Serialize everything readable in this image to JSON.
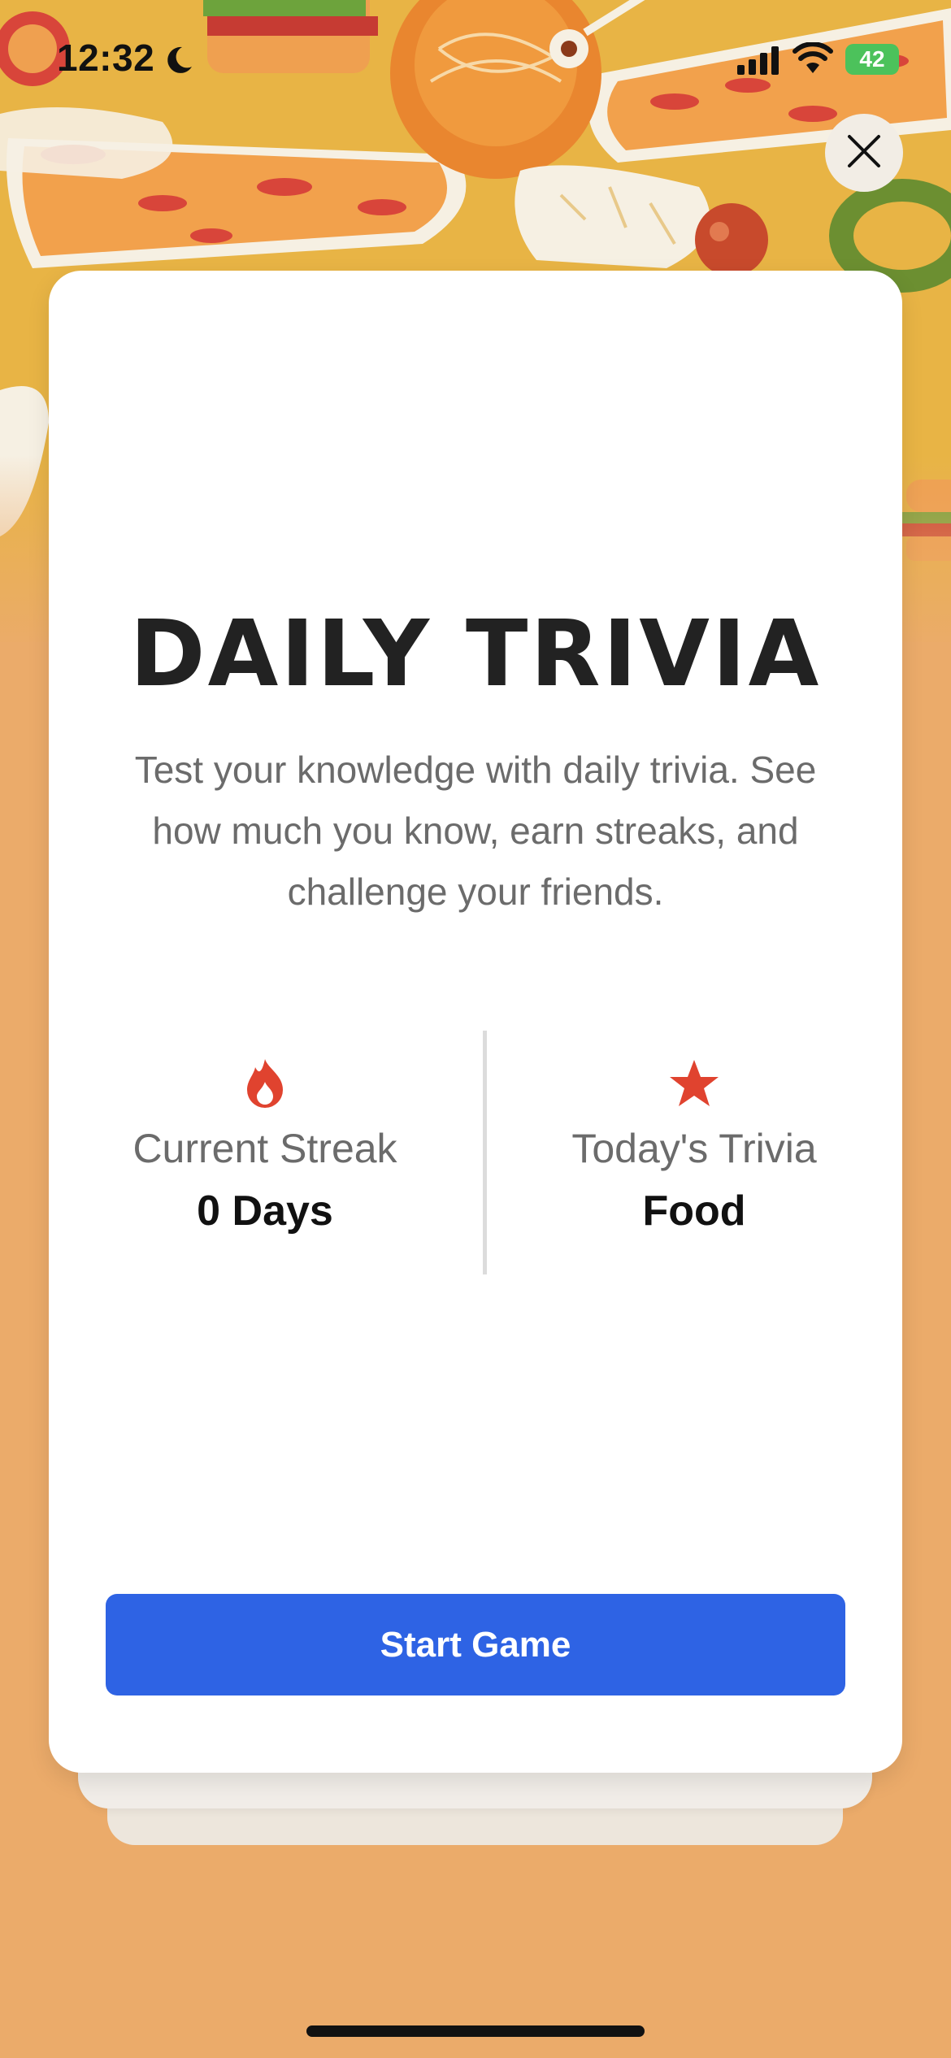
{
  "status_bar": {
    "time": "12:32",
    "battery": "42",
    "icons": [
      "moon-icon",
      "cellular-signal-icon",
      "wifi-icon",
      "battery-charging-icon"
    ]
  },
  "header": {
    "close_icon": "close-icon"
  },
  "card": {
    "title": "DAILY TRIVIA",
    "description": "Test your knowledge with daily trivia. See how much you know, earn streaks, and challenge your friends.",
    "stats": [
      {
        "icon": "flame-icon",
        "label": "Current Streak",
        "value": "0 Days"
      },
      {
        "icon": "star-icon",
        "label": "Today's Trivia",
        "value": "Food"
      }
    ],
    "start_button": "Start Game"
  },
  "colors": {
    "background": "#EBAB6A",
    "hero": "#E8B445",
    "accent_red": "#E0432F",
    "button_blue": "#2E63E4"
  }
}
